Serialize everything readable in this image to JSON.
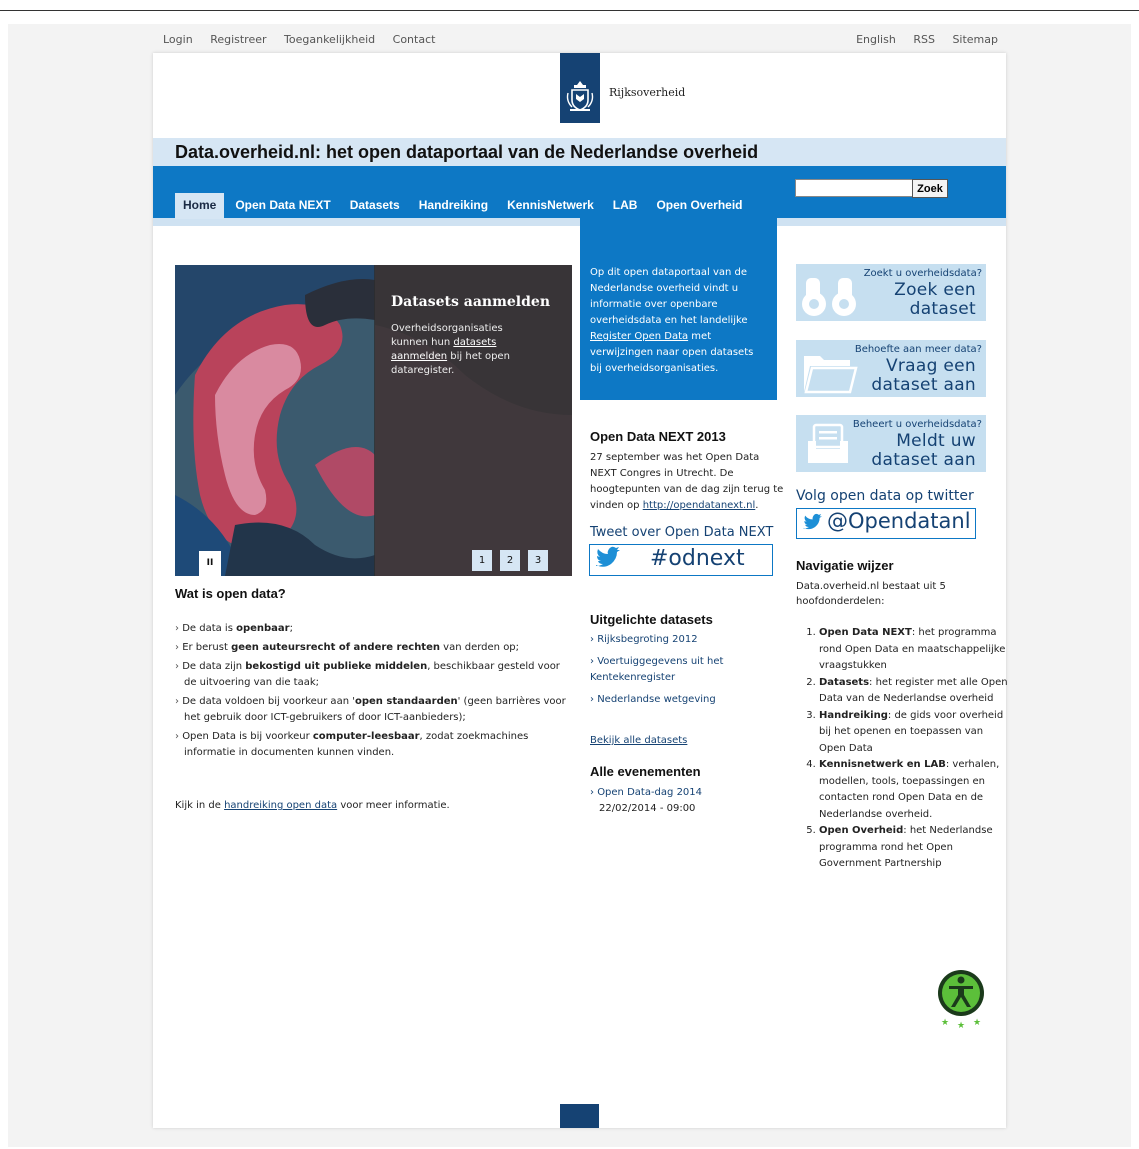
{
  "utility": {
    "left": [
      "Login",
      "Registreer",
      "Toegankelijkheid",
      "Contact"
    ],
    "right": [
      "English",
      "RSS",
      "Sitemap"
    ]
  },
  "header": {
    "logo_text": "Rijksoverheid",
    "title": "Data.overheid.nl: het open dataportaal van de Nederlandse overheid"
  },
  "nav": {
    "items": [
      "Home",
      "Open Data NEXT",
      "Datasets",
      "Handreiking",
      "KennisNetwerk",
      "LAB",
      "Open Overheid"
    ],
    "active": "Home"
  },
  "search": {
    "value": "",
    "button": "Zoek"
  },
  "slider": {
    "title": "Datasets aanmelden",
    "text_before": "Overheidsorganisaties kunnen hun ",
    "link": "datasets aanmelden",
    "text_after": " bij het open dataregister.",
    "pause": "II",
    "pages": [
      "1",
      "2",
      "3"
    ]
  },
  "intro": {
    "text_before": "Op dit open dataportaal van de Nederlandse overheid vindt u informatie over openbare overheidsdata en het landelijke ",
    "link": "Register Open Data",
    "text_after": " met verwijzingen naar open datasets bij overheidsorganisaties."
  },
  "odn": {
    "title": "Open Data NEXT 2013",
    "text": "27 september was het Open Data NEXT Congres in Utrecht. De hoogtepunten van de dag zijn terug te vinden op ",
    "link": "http://opendatanext.nl",
    "dot": ".",
    "tweet_label": "Tweet over Open Data NEXT",
    "hashtag": "#odnext"
  },
  "uitgelicht": {
    "title": "Uitgelichte datasets",
    "items": [
      "Rijksbegroting 2012",
      "Voertuiggegevens uit het Kentekenregister",
      "Nederlandse wetgeving"
    ],
    "all_link": "Bekijk alle datasets"
  },
  "events": {
    "title": "Alle evenementen",
    "item": "Open Data-dag 2014",
    "date": "22/02/2014 - 09:00"
  },
  "wat": {
    "title": "Wat is open data?",
    "items": [
      {
        "a": "De data is ",
        "b": "openbaar",
        "c": ";"
      },
      {
        "a": "Er berust ",
        "b": "geen auteursrecht of andere rechten",
        "c": " van derden op;"
      },
      {
        "a": "De data zijn ",
        "b": "bekostigd uit publieke middelen",
        "c": ", beschikbaar gesteld voor de uitvoering van die taak;"
      },
      {
        "a": "De data voldoen bij voorkeur aan '",
        "b": "open standaarden",
        "c": "' (geen barrières voor het gebruik door ICT-gebruikers of door ICT-aanbieders);"
      },
      {
        "a": "Open Data is bij voorkeur ",
        "b": "computer-leesbaar",
        "c": ", zodat zoekmachines informatie in documenten kunnen vinden."
      }
    ],
    "kijk_before": "Kijk in de ",
    "kijk_link": "handreiking open data",
    "kijk_after": " voor meer informatie."
  },
  "cta": [
    {
      "small": "Zoekt u overheidsdata?",
      "big1": "Zoek een",
      "big2": "dataset"
    },
    {
      "small": "Behoefte aan meer data?",
      "big1": "Vraag een",
      "big2": "dataset aan"
    },
    {
      "small": "Beheert u overheidsdata?",
      "big1": "Meldt uw",
      "big2": "dataset aan"
    }
  ],
  "twitter": {
    "label": "Volg open data op twitter",
    "handle": "@Opendatanl"
  },
  "wijzer": {
    "title": "Navigatie wijzer",
    "intro": "Data.overheid.nl bestaat uit 5 hoofdonderdelen:",
    "items": [
      {
        "b": "Open Data NEXT",
        "t": ": het programma rond Open Data en maatschappelijke vraagstukken"
      },
      {
        "b": "Datasets",
        "t": ": het register met alle Open Data van de Nederlandse overheid"
      },
      {
        "b": "Handreiking",
        "t": ": de gids voor overheid bij het openen en toepassen van Open Data"
      },
      {
        "b": "Kennisnetwerk en LAB",
        "t": ": verhalen, modellen, tools, toepassingen en contacten rond Open Data en de Nederlandse overheid."
      },
      {
        "b": "Open Overheid",
        "t": ": het Nederlandse programma rond het Open Government Partnership"
      }
    ]
  }
}
